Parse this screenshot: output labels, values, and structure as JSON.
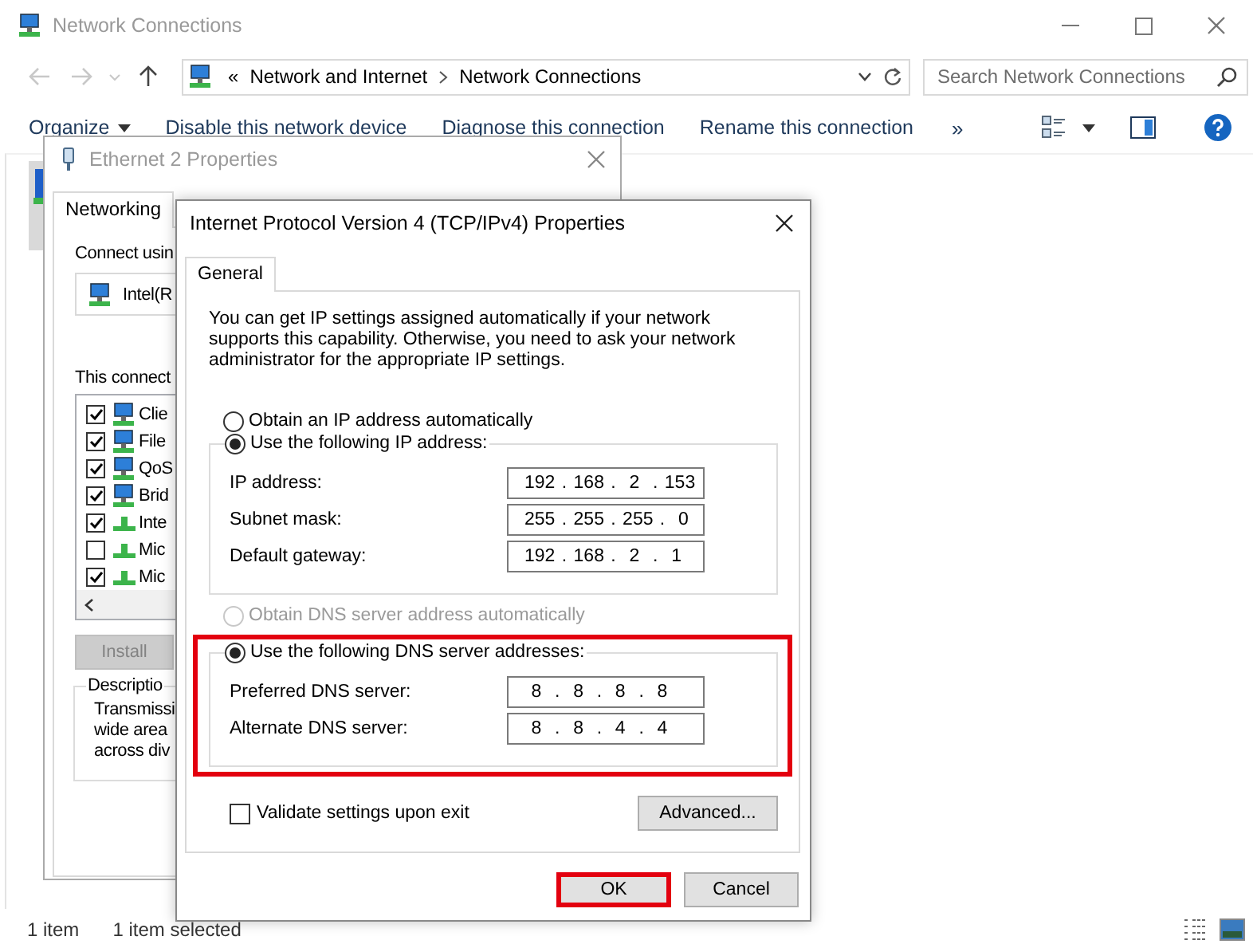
{
  "window": {
    "title": "Network Connections"
  },
  "navigation": {
    "back_disabled": true,
    "forward_disabled": true
  },
  "address_bar": {
    "overflow": "«",
    "crumbs": [
      "Network and Internet",
      "Network Connections"
    ]
  },
  "search": {
    "placeholder": "Search Network Connections"
  },
  "toolbar": {
    "items": [
      {
        "label": "Organize",
        "kind": "menu"
      },
      {
        "label": "Disable this network device",
        "kind": "action"
      },
      {
        "label": "Diagnose this connection",
        "kind": "action"
      },
      {
        "label": "Rename this connection",
        "kind": "action"
      }
    ],
    "more": "»"
  },
  "status_bar": {
    "items": [
      "1 item",
      "1 item selected"
    ]
  },
  "ethernet_dialog": {
    "title": "Ethernet 2 Properties",
    "tabs": [
      {
        "label": "Networking",
        "selected": true
      }
    ],
    "connect_using": "Connect usin",
    "adapter": "Intel(R",
    "components_label": "This connect",
    "components": [
      {
        "label": "Clie",
        "checked": true,
        "kind": "service"
      },
      {
        "label": "File",
        "checked": true,
        "kind": "service"
      },
      {
        "label": "QoS",
        "checked": true,
        "kind": "service"
      },
      {
        "label": "Brid",
        "checked": true,
        "kind": "service"
      },
      {
        "label": "Inte",
        "checked": true,
        "kind": "protocol"
      },
      {
        "label": "Mic",
        "checked": false,
        "kind": "protocol"
      },
      {
        "label": "Mic",
        "checked": true,
        "kind": "protocol"
      }
    ],
    "install_button": {
      "label": "Install",
      "disabled": true
    },
    "description": {
      "title": "Descriptio",
      "lines": [
        "Transmissi",
        "wide area",
        "across div"
      ]
    }
  },
  "ipv4_dialog": {
    "title": "Internet Protocol Version 4 (TCP/IPv4) Properties",
    "tabs": [
      {
        "label": "General",
        "selected": true
      }
    ],
    "intro": "You can get IP settings assigned automatically if your network supports this capability. Otherwise, you need to ask your network administrator for the appropriate IP settings.",
    "ip_options": [
      {
        "label": "Obtain an IP address automatically",
        "selected": false,
        "disabled": false
      },
      {
        "label": "Use the following IP address:",
        "selected": true,
        "disabled": false
      }
    ],
    "ip_fields": [
      {
        "label": "IP address:",
        "value": "192 . 168 .  2  . 153"
      },
      {
        "label": "Subnet mask:",
        "value": "255 . 255 . 255 .  0"
      },
      {
        "label": "Default gateway:",
        "value": "192 . 168 .  2  .  1"
      }
    ],
    "dns_options": [
      {
        "label": "Obtain DNS server address automatically",
        "selected": false,
        "disabled": true
      },
      {
        "label": "Use the following DNS server addresses:",
        "selected": true,
        "disabled": false
      }
    ],
    "dns_fields": [
      {
        "label": "Preferred DNS server:",
        "value": " 8  .  8  .  8  .  8"
      },
      {
        "label": "Alternate DNS server:",
        "value": " 8  .  8  .  4  .  4"
      }
    ],
    "dns_highlighted": true,
    "validate": {
      "label": "Validate settings upon exit",
      "checked": false
    },
    "advanced_button": "Advanced...",
    "ok_button": {
      "label": "OK",
      "highlighted": true
    },
    "cancel_button": "Cancel"
  }
}
